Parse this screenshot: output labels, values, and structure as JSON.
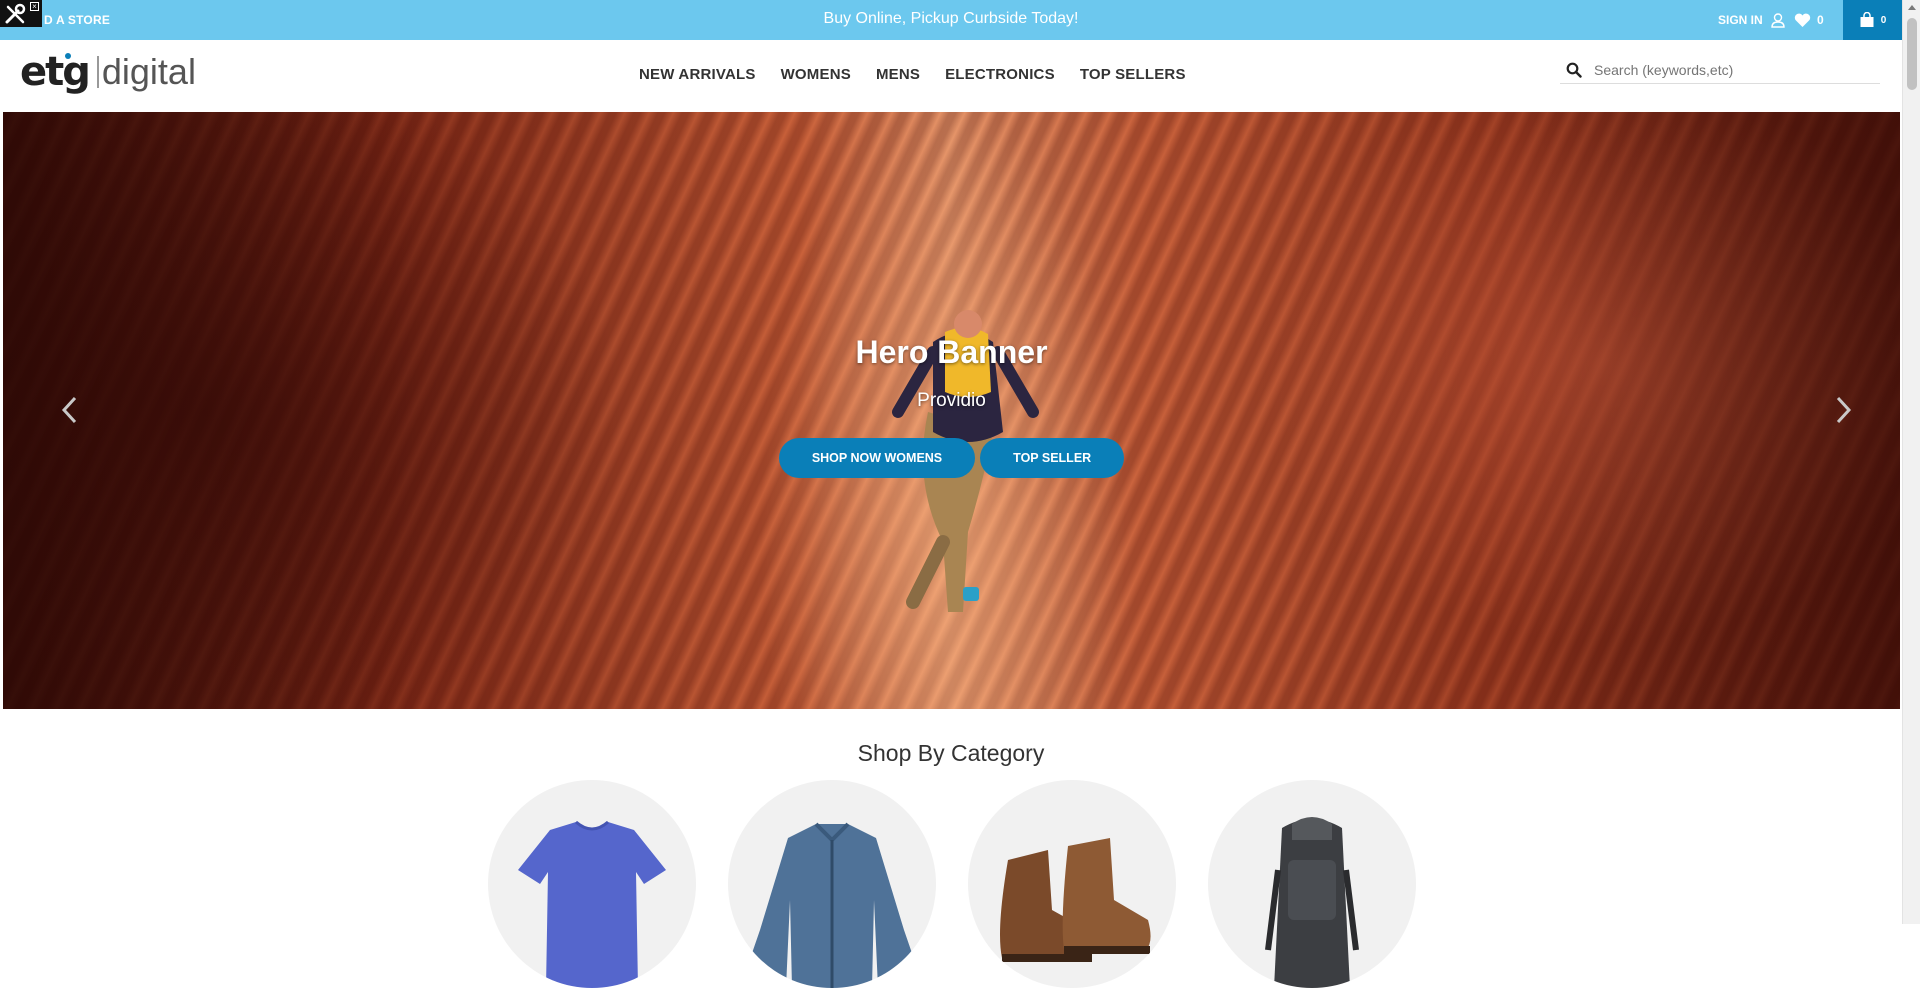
{
  "topbar": {
    "find_store": "D A STORE",
    "promo": "Buy Online, Pickup Curbside Today!",
    "sign_in": "SIGN IN",
    "wishlist_count": "0",
    "cart_count": "0"
  },
  "header": {
    "logo_left": "etg",
    "logo_right": "digital",
    "nav": [
      "NEW ARRIVALS",
      "WOMENS",
      "MENS",
      "ELECTRONICS",
      "TOP SELLERS"
    ],
    "search_placeholder": "Search (keywords,etc)"
  },
  "hero": {
    "title": "Hero Banner",
    "subtitle": "Providio",
    "buttons": [
      "SHOP NOW WOMENS",
      "TOP SELLER"
    ]
  },
  "categories": {
    "title": "Shop By Category",
    "items": [
      "t-shirt",
      "jacket",
      "boots",
      "backpack"
    ]
  },
  "colors": {
    "topbar": "#6cc8ee",
    "accent": "#0a7fb8"
  }
}
